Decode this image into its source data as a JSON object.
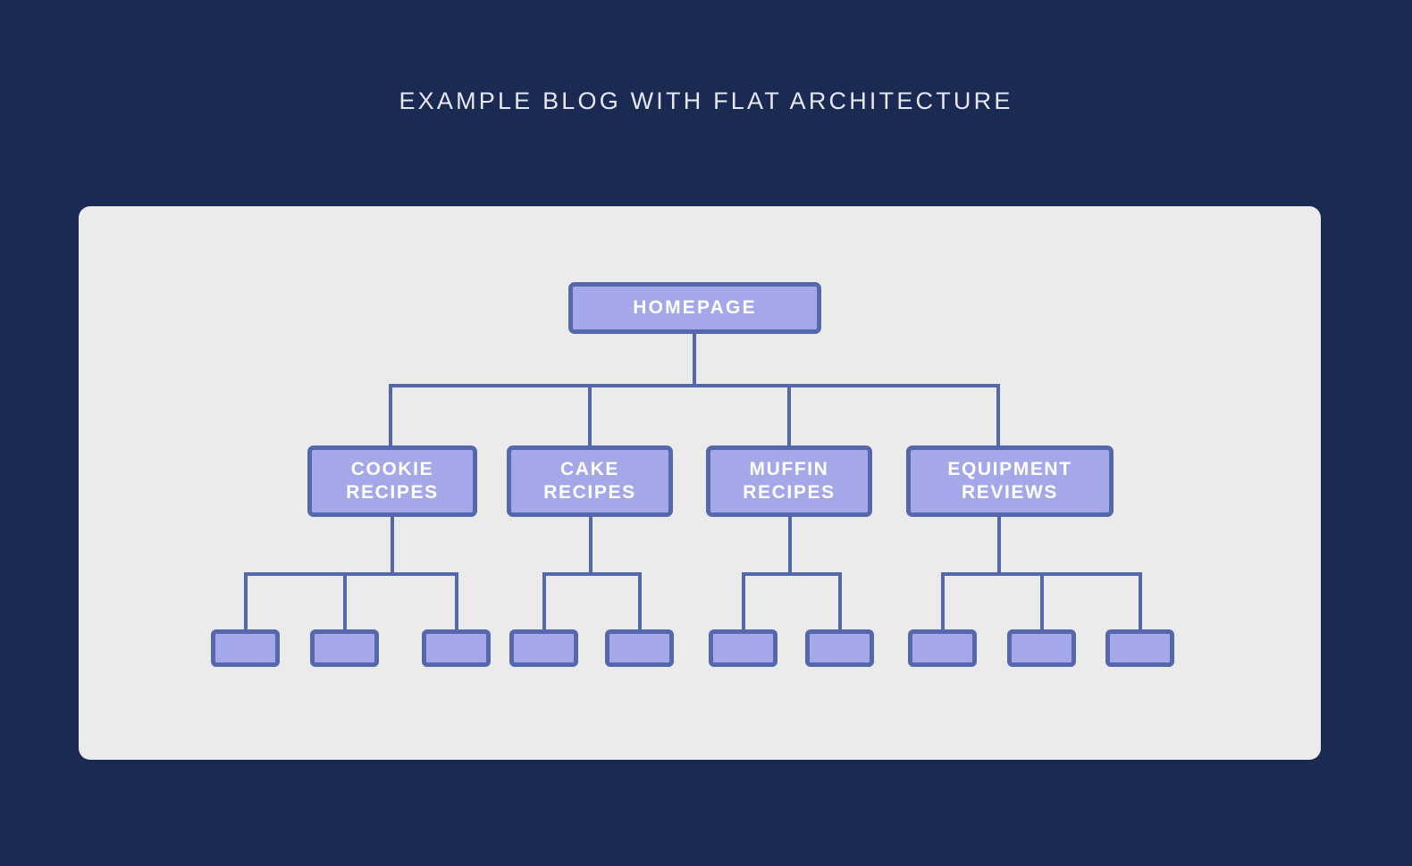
{
  "page": {
    "title": "EXAMPLE BLOG WITH FLAT ARCHITECTURE",
    "background_color": "#1a2a52",
    "card_color": "#ebebeb",
    "title_color": "#e6e8ee"
  },
  "diagram": {
    "type": "site-architecture-tree",
    "node_fill_color": "#a5a8e8",
    "node_border_color": "#5568ab",
    "node_text_color": "#ffffff",
    "connector_color": "#5568ab",
    "levels": 3,
    "root": {
      "label": "HOMEPAGE"
    },
    "categories": [
      {
        "label": "COOKIE\nRECIPES",
        "children_count": 3
      },
      {
        "label": "CAKE\nRECIPES",
        "children_count": 2
      },
      {
        "label": "MUFFIN\nRECIPES",
        "children_count": 2
      },
      {
        "label": "EQUIPMENT\nREVIEWS",
        "children_count": 3
      }
    ],
    "leaves": [
      {
        "label": ""
      },
      {
        "label": ""
      },
      {
        "label": ""
      },
      {
        "label": ""
      },
      {
        "label": ""
      },
      {
        "label": ""
      },
      {
        "label": ""
      },
      {
        "label": ""
      },
      {
        "label": ""
      },
      {
        "label": ""
      }
    ]
  }
}
